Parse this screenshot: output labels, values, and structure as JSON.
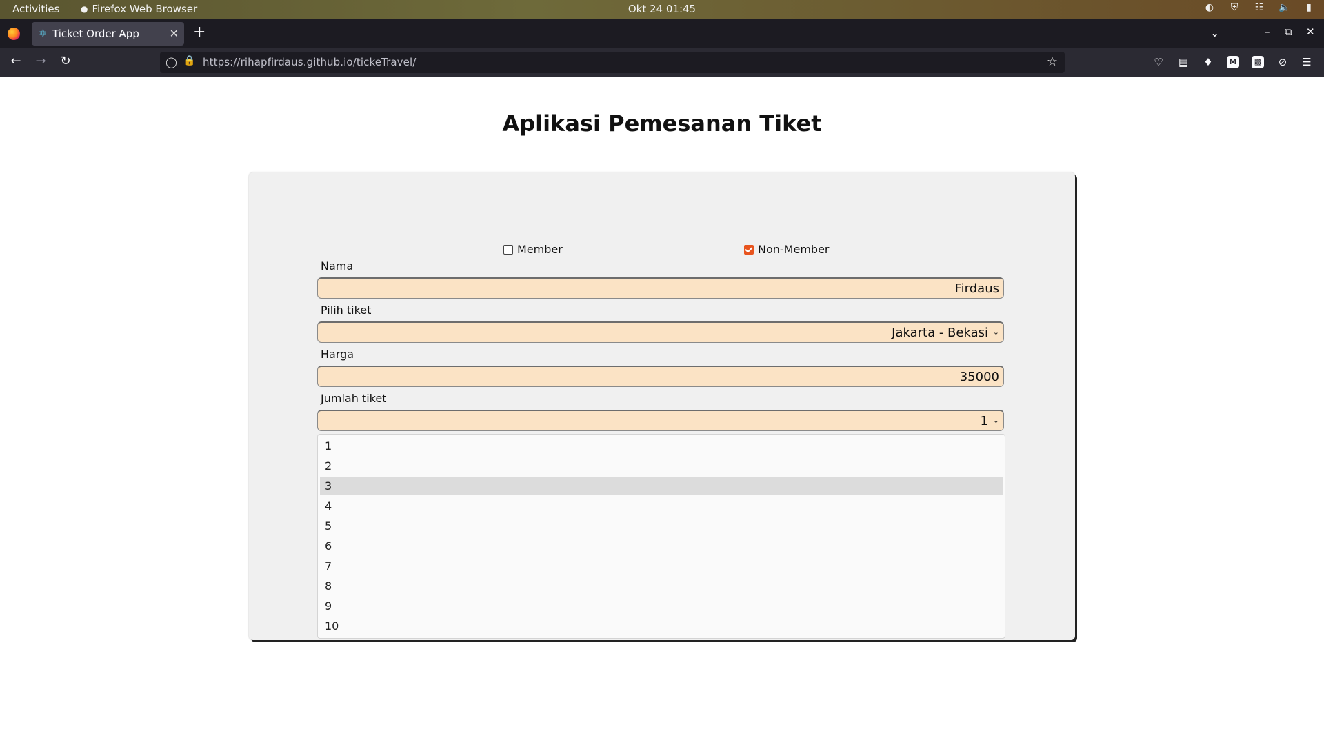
{
  "topbar": {
    "activities": "Activities",
    "app_name": "Firefox Web Browser",
    "clock": "Okt 24  01:45"
  },
  "browser": {
    "tab_title": "Ticket Order App",
    "url_host": "https://rihapfirdaus.github.io",
    "url_path": "/tickeTravel/"
  },
  "page": {
    "title": "Aplikasi Pemesanan Tiket",
    "member_label": "Member",
    "member_checked": false,
    "nonmember_label": "Non-Member",
    "nonmember_checked": true,
    "nama_label": "Nama",
    "nama_value": "Firdaus",
    "tiket_label": "Pilih tiket",
    "tiket_value": "Jakarta - Bekasi",
    "harga_label": "Harga",
    "harga_value": "35000",
    "jumlah_label": "Jumlah tiket",
    "jumlah_value": "1",
    "jumlah_options": [
      "1",
      "2",
      "3",
      "4",
      "5",
      "6",
      "7",
      "8",
      "9",
      "10"
    ],
    "highlighted_option": "3"
  },
  "colors": {
    "field_bg": "#fbe3c5",
    "card_bg": "#f0f0f0",
    "checkbox_accent": "#e8541e"
  }
}
